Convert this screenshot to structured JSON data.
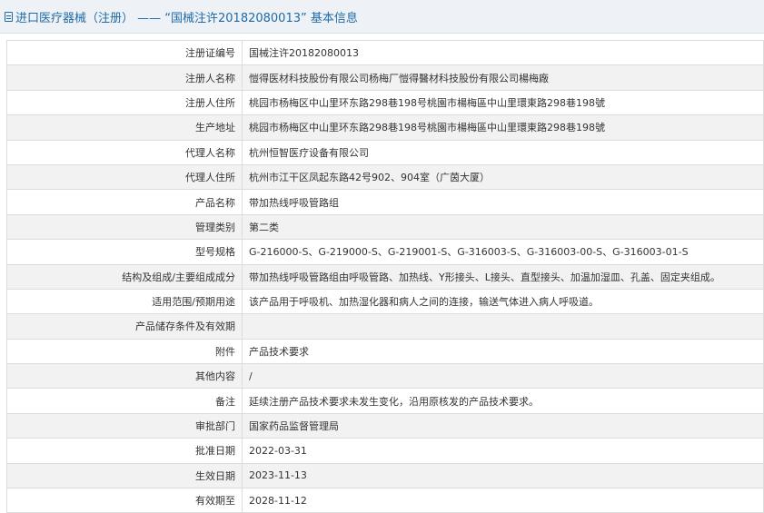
{
  "header": {
    "breadcrumb": "进口医疗器械（注册） —— “国械注许20182080013” 基本信息"
  },
  "rows": [
    {
      "label": "注册证编号",
      "value": "国械注许20182080013"
    },
    {
      "label": "注册人名称",
      "value": "愷得医材科技股份有限公司杨梅厂愷得醫材科技股份有限公司楊梅廠"
    },
    {
      "label": "注册人住所",
      "value": "桃园市杨梅区中山里环东路298巷198号桃園市楊梅區中山里環東路298巷198號"
    },
    {
      "label": "生产地址",
      "value": "桃园市杨梅区中山里环东路298巷198号桃園市楊梅區中山里環東路298巷198號"
    },
    {
      "label": "代理人名称",
      "value": "杭州恒智医疗设备有限公司"
    },
    {
      "label": "代理人住所",
      "value": "杭州市江干区凤起东路42号902、904室（广茵大厦）"
    },
    {
      "label": "产品名称",
      "value": "带加热线呼吸管路组"
    },
    {
      "label": "管理类别",
      "value": "第二类"
    },
    {
      "label": "型号规格",
      "value": "G-216000-S、G-219000-S、G-219001-S、G-316003-S、G-316003-00-S、G-316003-01-S"
    },
    {
      "label": "结构及组成/主要组成成分",
      "value": "带加热线呼吸管路组由呼吸管路、加热线、Y形接头、L接头、直型接头、加温加湿皿、孔盖、固定夹组成。"
    },
    {
      "label": "适用范围/预期用途",
      "value": "该产品用于呼吸机、加热湿化器和病人之间的连接，输送气体进入病人呼吸道。"
    },
    {
      "label": "产品储存条件及有效期",
      "value": ""
    },
    {
      "label": "附件",
      "value": "产品技术要求"
    },
    {
      "label": "其他内容",
      "value": "/"
    },
    {
      "label": "备注",
      "value": "延续注册产品技术要求未发生变化，沿用原核发的产品技术要求。"
    },
    {
      "label": "审批部门",
      "value": "国家药品监督管理局"
    },
    {
      "label": "批准日期",
      "value": "2022-03-31"
    },
    {
      "label": "生效日期",
      "value": "2023-11-13"
    },
    {
      "label": "有效期至",
      "value": "2028-11-12"
    }
  ]
}
